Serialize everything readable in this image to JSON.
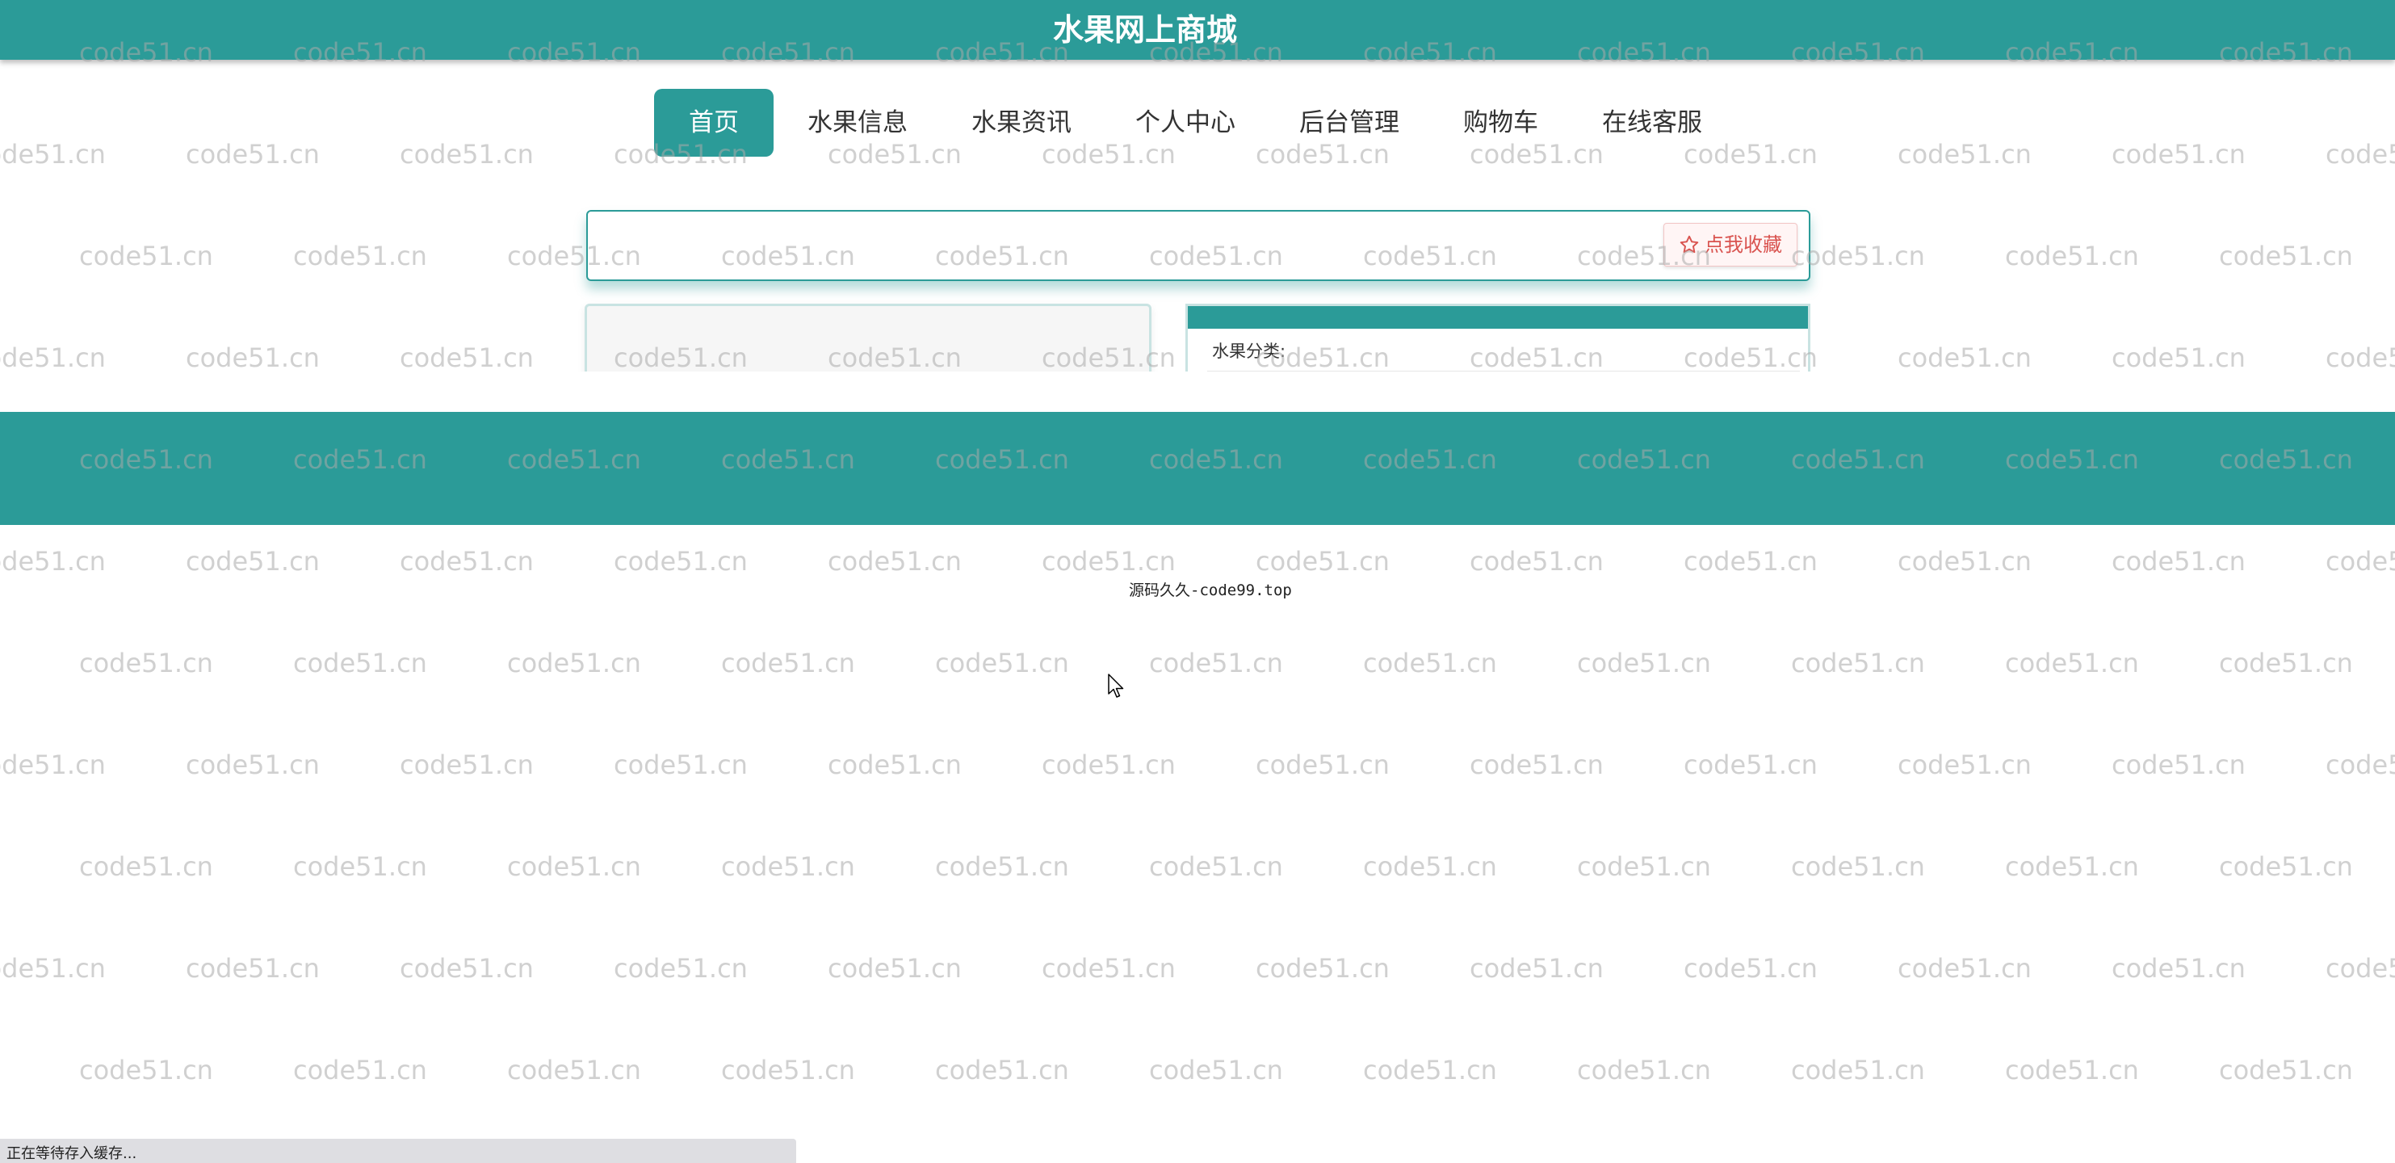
{
  "header": {
    "title": "水果网上商城"
  },
  "nav": {
    "items": [
      {
        "label": "首页",
        "active": true
      },
      {
        "label": "水果信息",
        "active": false
      },
      {
        "label": "水果资讯",
        "active": false
      },
      {
        "label": "个人中心",
        "active": false
      },
      {
        "label": "后台管理",
        "active": false
      },
      {
        "label": "购物车",
        "active": false
      },
      {
        "label": "在线客服",
        "active": false
      }
    ]
  },
  "collect": {
    "button_label": "点我收藏",
    "icon": "star-outline-icon"
  },
  "product_info": {
    "category_label": "水果分类:"
  },
  "footer": {
    "text": "源码久久-code99.top"
  },
  "watermark": {
    "text": "code51.cn"
  },
  "status_bar": {
    "text": "正在等待存入缓存..."
  },
  "colors": {
    "primary": "#2b9b98",
    "collect_text": "#d9534f",
    "status_bar_bg": "#dedee2"
  }
}
